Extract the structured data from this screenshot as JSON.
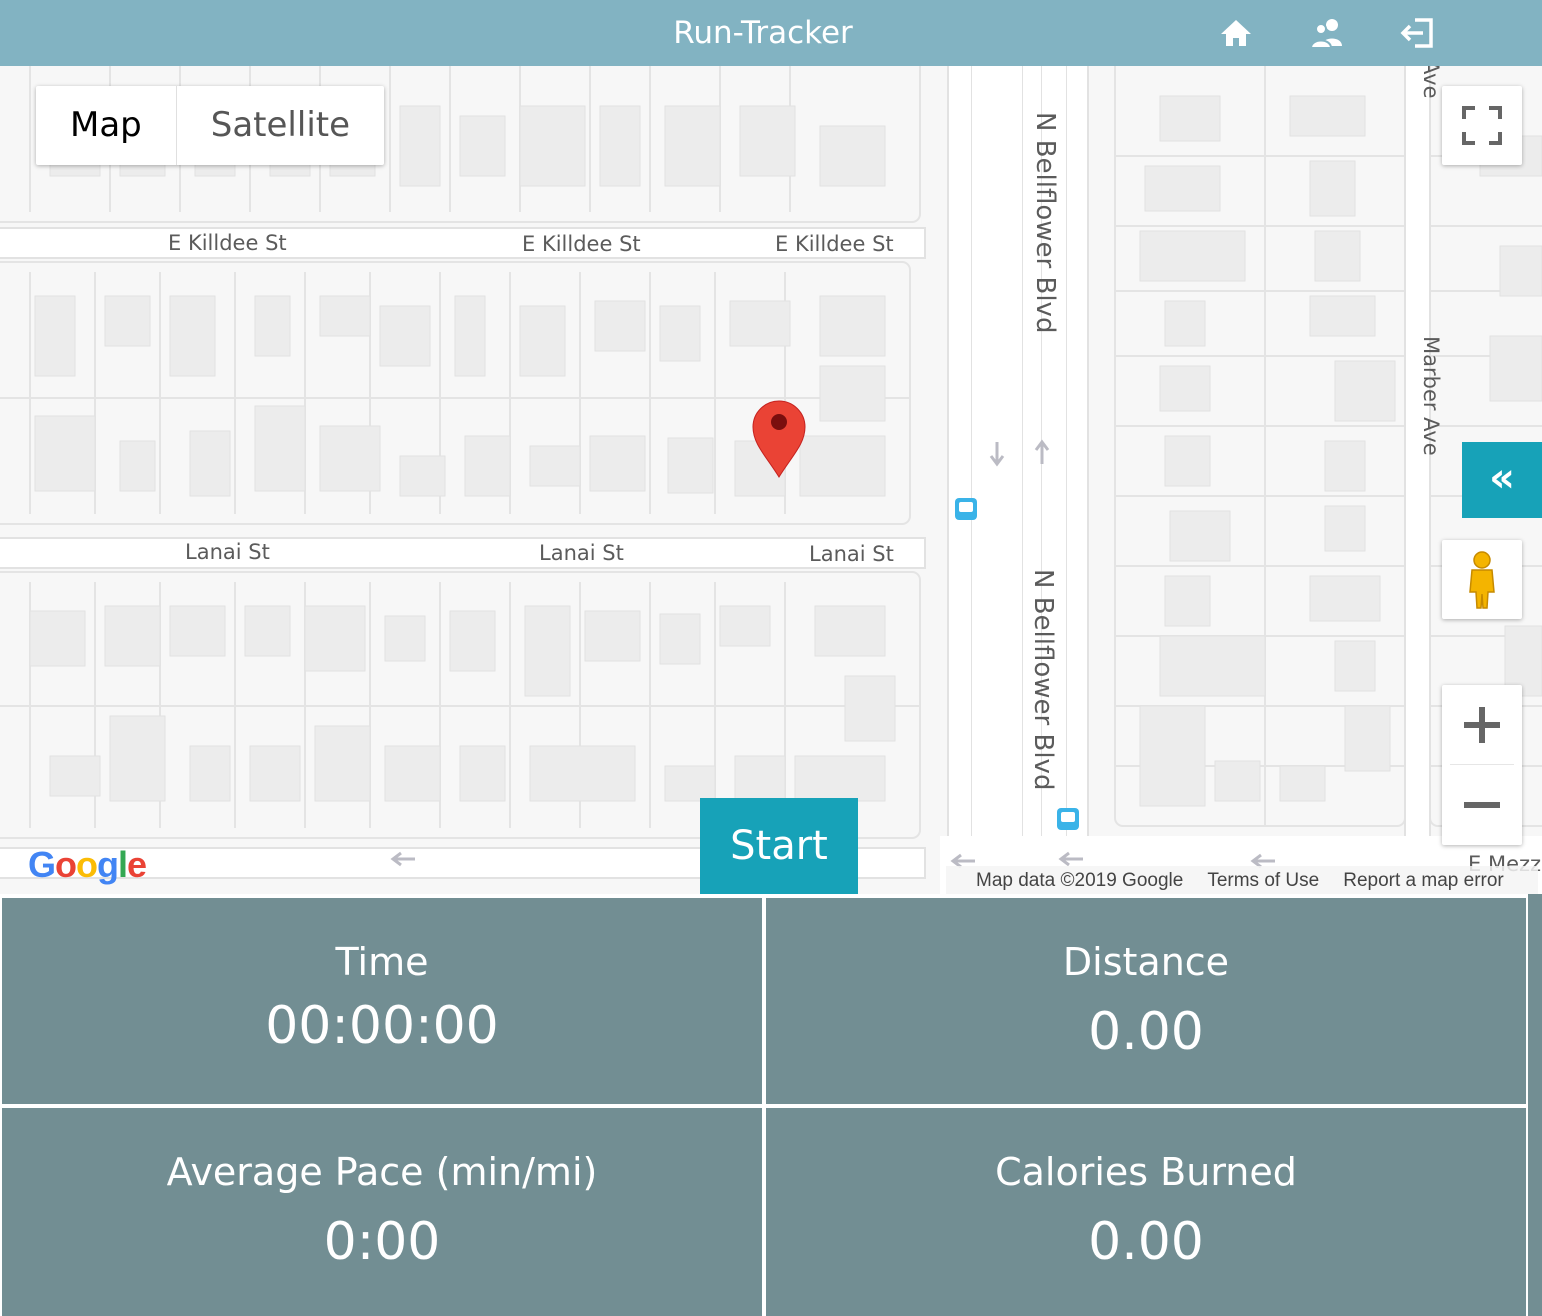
{
  "header": {
    "title": "Run-Tracker",
    "icons": [
      "home-icon",
      "users-icon",
      "logout-icon"
    ]
  },
  "map": {
    "map_type": {
      "map_label": "Map",
      "satellite_label": "Satellite",
      "selected": "Map"
    },
    "streets": {
      "killdee": "E Killdee St",
      "lanai": "Lanai St",
      "bellflower": "N Bellflower Blvd",
      "marber": "Marber Ave",
      "marber_top": "Ave",
      "mezz": "E Mezz"
    },
    "controls": {
      "fullscreen_icon": "fullscreen-icon",
      "collapse_label": "«",
      "pegman_icon": "pegman-icon",
      "zoom_in_icon": "plus-icon",
      "zoom_out_icon": "minus-icon"
    },
    "start_label": "Start",
    "google_logo": "Google",
    "footer": {
      "map_data": "Map data ©2019 Google",
      "terms": "Terms of Use",
      "report": "Report a map error"
    },
    "colors": {
      "marker": "#ea4335",
      "accent": "#17a2b8",
      "header": "#82b3c2"
    }
  },
  "stats": {
    "time": {
      "label": "Time",
      "value": "00:00:00"
    },
    "distance": {
      "label": "Distance",
      "value": "0.00"
    },
    "pace": {
      "label": "Average Pace (min/mi)",
      "value": "0:00"
    },
    "calories": {
      "label": "Calories Burned",
      "value": "0.00"
    },
    "panel_color": "#728e93"
  }
}
